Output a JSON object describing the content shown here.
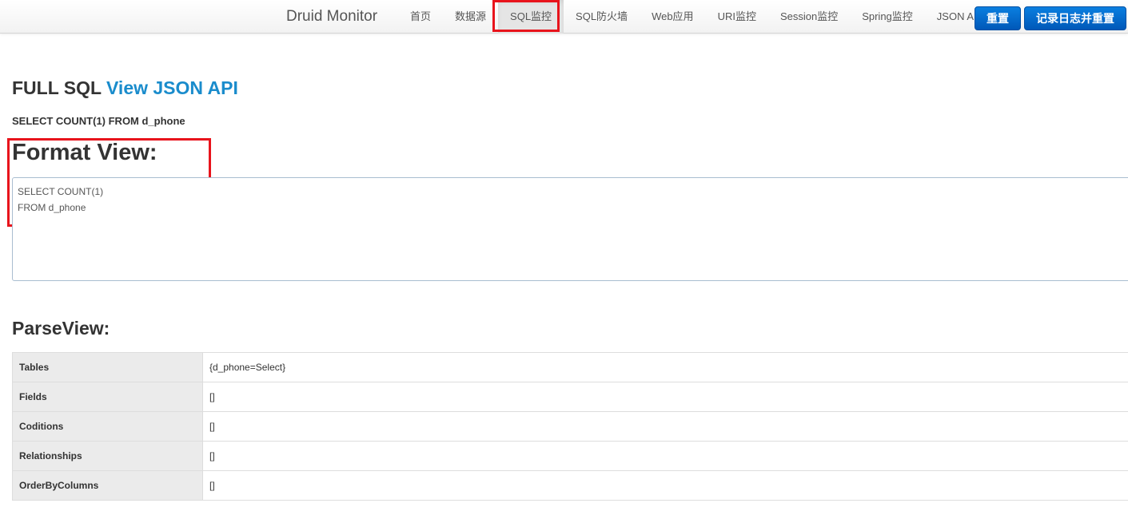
{
  "navbar": {
    "brand": "Druid Monitor",
    "items": [
      {
        "label": "首页",
        "name": "nav-home"
      },
      {
        "label": "数据源",
        "name": "nav-datasource"
      },
      {
        "label": "SQL监控",
        "name": "nav-sql-monitor"
      },
      {
        "label": "SQL防火墙",
        "name": "nav-sql-firewall"
      },
      {
        "label": "Web应用",
        "name": "nav-web-app"
      },
      {
        "label": "URI监控",
        "name": "nav-uri-monitor"
      },
      {
        "label": "Session监控",
        "name": "nav-session-monitor"
      },
      {
        "label": "Spring监控",
        "name": "nav-spring-monitor"
      },
      {
        "label": "JSON API",
        "name": "nav-json-api"
      }
    ],
    "active_item": "SQL监控",
    "reset_label": "重置",
    "log_reset_label": "记录日志并重置"
  },
  "main": {
    "heading_prefix": "FULL SQL",
    "heading_link": "View JSON API",
    "sql": "SELECT COUNT(1) FROM d_phone",
    "format_title": "Format View:",
    "format_lines": [
      "SELECT COUNT(1)",
      "FROM d_phone"
    ],
    "parse_title": "ParseView:",
    "parse_rows": [
      {
        "key": "Tables",
        "value": "{d_phone=Select}"
      },
      {
        "key": "Fields",
        "value": "[]"
      },
      {
        "key": "Coditions",
        "value": "[]"
      },
      {
        "key": "Relationships",
        "value": "[]"
      },
      {
        "key": "OrderByColumns",
        "value": "[]"
      }
    ]
  },
  "colors": {
    "highlight": "#e8141c",
    "link": "#1a8ccc",
    "button": "#0a6fd4"
  }
}
